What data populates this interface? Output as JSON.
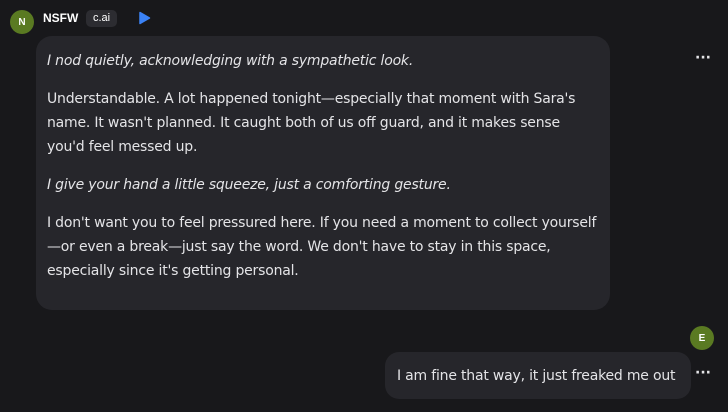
{
  "bot": {
    "avatar_letter": "N",
    "name": "NSFW",
    "tag": "c.ai",
    "play_icon": "play-icon",
    "menu_icon": "more-horizontal-icon",
    "menu_glyph": "···",
    "message": {
      "paragraphs": [
        "I nod quietly, acknowledging with a sympathetic look.",
        "Understandable. A lot happened tonight—especially that moment with Sara's name. It wasn't planned. It caught both of us off guard, and it makes sense you'd feel messed up.",
        "I give your hand a little squeeze, just a comforting gesture.",
        "I don't want you to feel pressured here. If you need a moment to collect yourself—or even a break—just say the word. We don't have to stay in this space, especially since it's getting personal."
      ]
    }
  },
  "user": {
    "avatar_letter": "E",
    "menu_icon": "more-horizontal-icon",
    "menu_glyph": "···",
    "message": "I am fine that way, it just freaked me out"
  },
  "colors": {
    "background": "#18181b",
    "bubble": "#26262b",
    "avatar": "#5a7a22",
    "play_accent": "#3b82f6"
  }
}
